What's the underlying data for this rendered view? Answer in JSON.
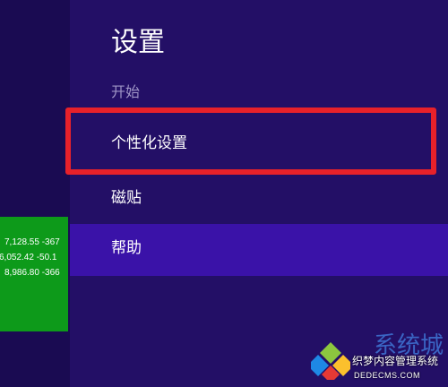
{
  "settings": {
    "title": "设置",
    "subtitle": "开始",
    "items": [
      {
        "label": "个性化设置",
        "highlighted": true
      },
      {
        "label": "磁贴"
      },
      {
        "label": "帮助",
        "selected": true
      }
    ]
  },
  "finance_tile": {
    "rows": [
      "7,128.55 -367",
      "6,052.42 -50.1",
      "8,986.80 -366"
    ]
  },
  "watermark": {
    "brand": "系统城",
    "text": "织梦内容管理系统",
    "url": "DEDECMS.COM"
  },
  "colors": {
    "pane_background": "#230f66",
    "selected_item": "#3a12a8",
    "highlight_frame": "#e8212a",
    "finance_tile": "#0d9a1a"
  }
}
